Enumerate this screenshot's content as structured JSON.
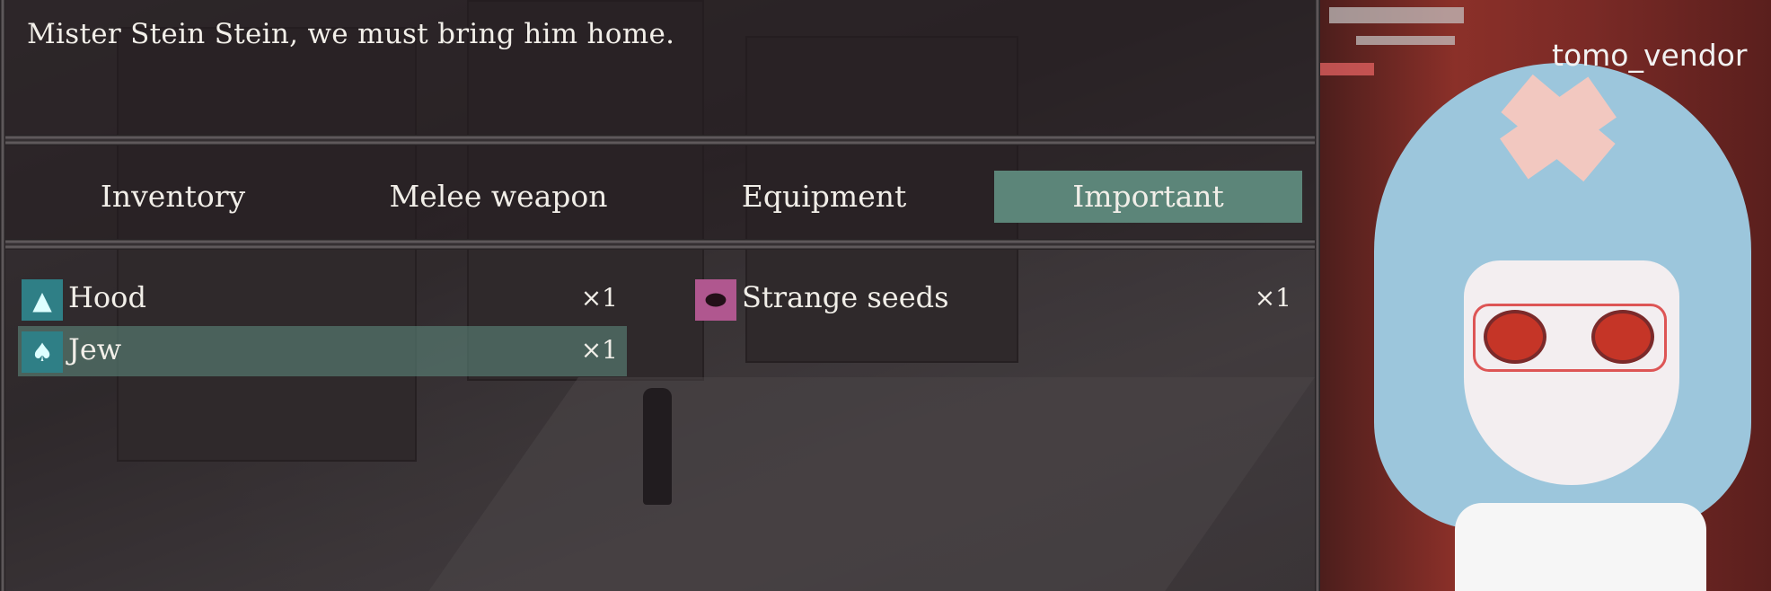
{
  "dialog": {
    "text": "Mister Stein Stein, we must bring him home."
  },
  "tabs": [
    {
      "label": "Inventory"
    },
    {
      "label": "Melee weapon"
    },
    {
      "label": "Equipment"
    },
    {
      "label": "Important"
    }
  ],
  "active_tab": "Important",
  "items": [
    {
      "name": "Hood",
      "qty": "×1",
      "icon": "hood-icon",
      "icon_color": "#2f7f86"
    },
    {
      "name": "Strange seeds",
      "qty": "×1",
      "icon": "seed-icon",
      "icon_color": "#b0578f"
    },
    {
      "name": "Jew",
      "qty": "×1",
      "icon": "figure-icon",
      "icon_color": "#2f7f86"
    }
  ],
  "selected_item": "Jew",
  "overlay": {
    "handle": "tomo_vendor"
  },
  "colors": {
    "accent": "#5c8579",
    "text": "#f1eee8"
  }
}
